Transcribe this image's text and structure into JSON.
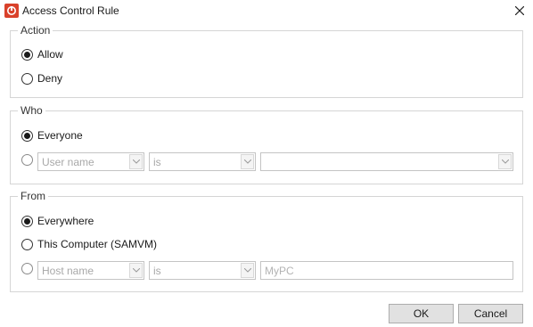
{
  "window": {
    "title": "Access Control Rule",
    "app_icon": "app-logo-icon",
    "close_icon": "close-icon"
  },
  "action_group": {
    "legend": "Action",
    "options": [
      {
        "label": "Allow",
        "checked": true
      },
      {
        "label": "Deny",
        "checked": false
      }
    ]
  },
  "who_group": {
    "legend": "Who",
    "everyone_label": "Everyone",
    "everyone_checked": true,
    "custom_checked": false,
    "field_placeholder": "User name",
    "operator_value": "is",
    "value_text": ""
  },
  "from_group": {
    "legend": "From",
    "everywhere_label": "Everywhere",
    "everywhere_checked": true,
    "this_computer_label": "This Computer (SAMVM)",
    "this_computer_checked": false,
    "custom_checked": false,
    "field_placeholder": "Host name",
    "operator_value": "is",
    "value_placeholder": "MyPC"
  },
  "buttons": {
    "ok": "OK",
    "cancel": "Cancel"
  }
}
